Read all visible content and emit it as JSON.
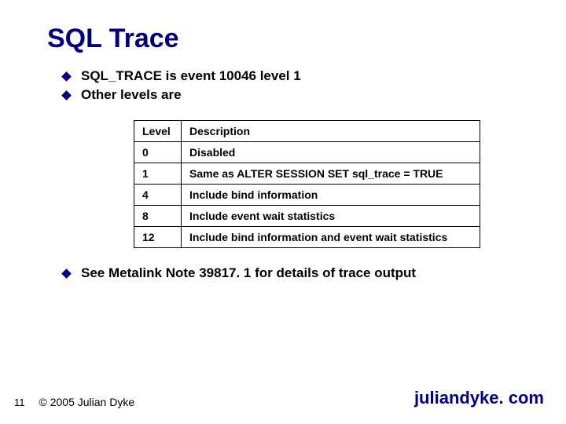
{
  "title": "SQL Trace",
  "bullets_top": [
    "SQL_TRACE is event 10046 level 1",
    "Other levels are"
  ],
  "table": {
    "headers": [
      "Level",
      "Description"
    ],
    "rows": [
      [
        "0",
        "Disabled"
      ],
      [
        "1",
        "Same as ALTER SESSION SET sql_trace = TRUE"
      ],
      [
        "4",
        "Include bind information"
      ],
      [
        "8",
        "Include event wait statistics"
      ],
      [
        "12",
        "Include bind information and event wait statistics"
      ]
    ]
  },
  "bullets_bottom": [
    "See Metalink Note 39817. 1 for details of trace output"
  ],
  "footer": {
    "page": "11",
    "copyright": "© 2005 Julian Dyke",
    "site": "juliandyke. com"
  }
}
